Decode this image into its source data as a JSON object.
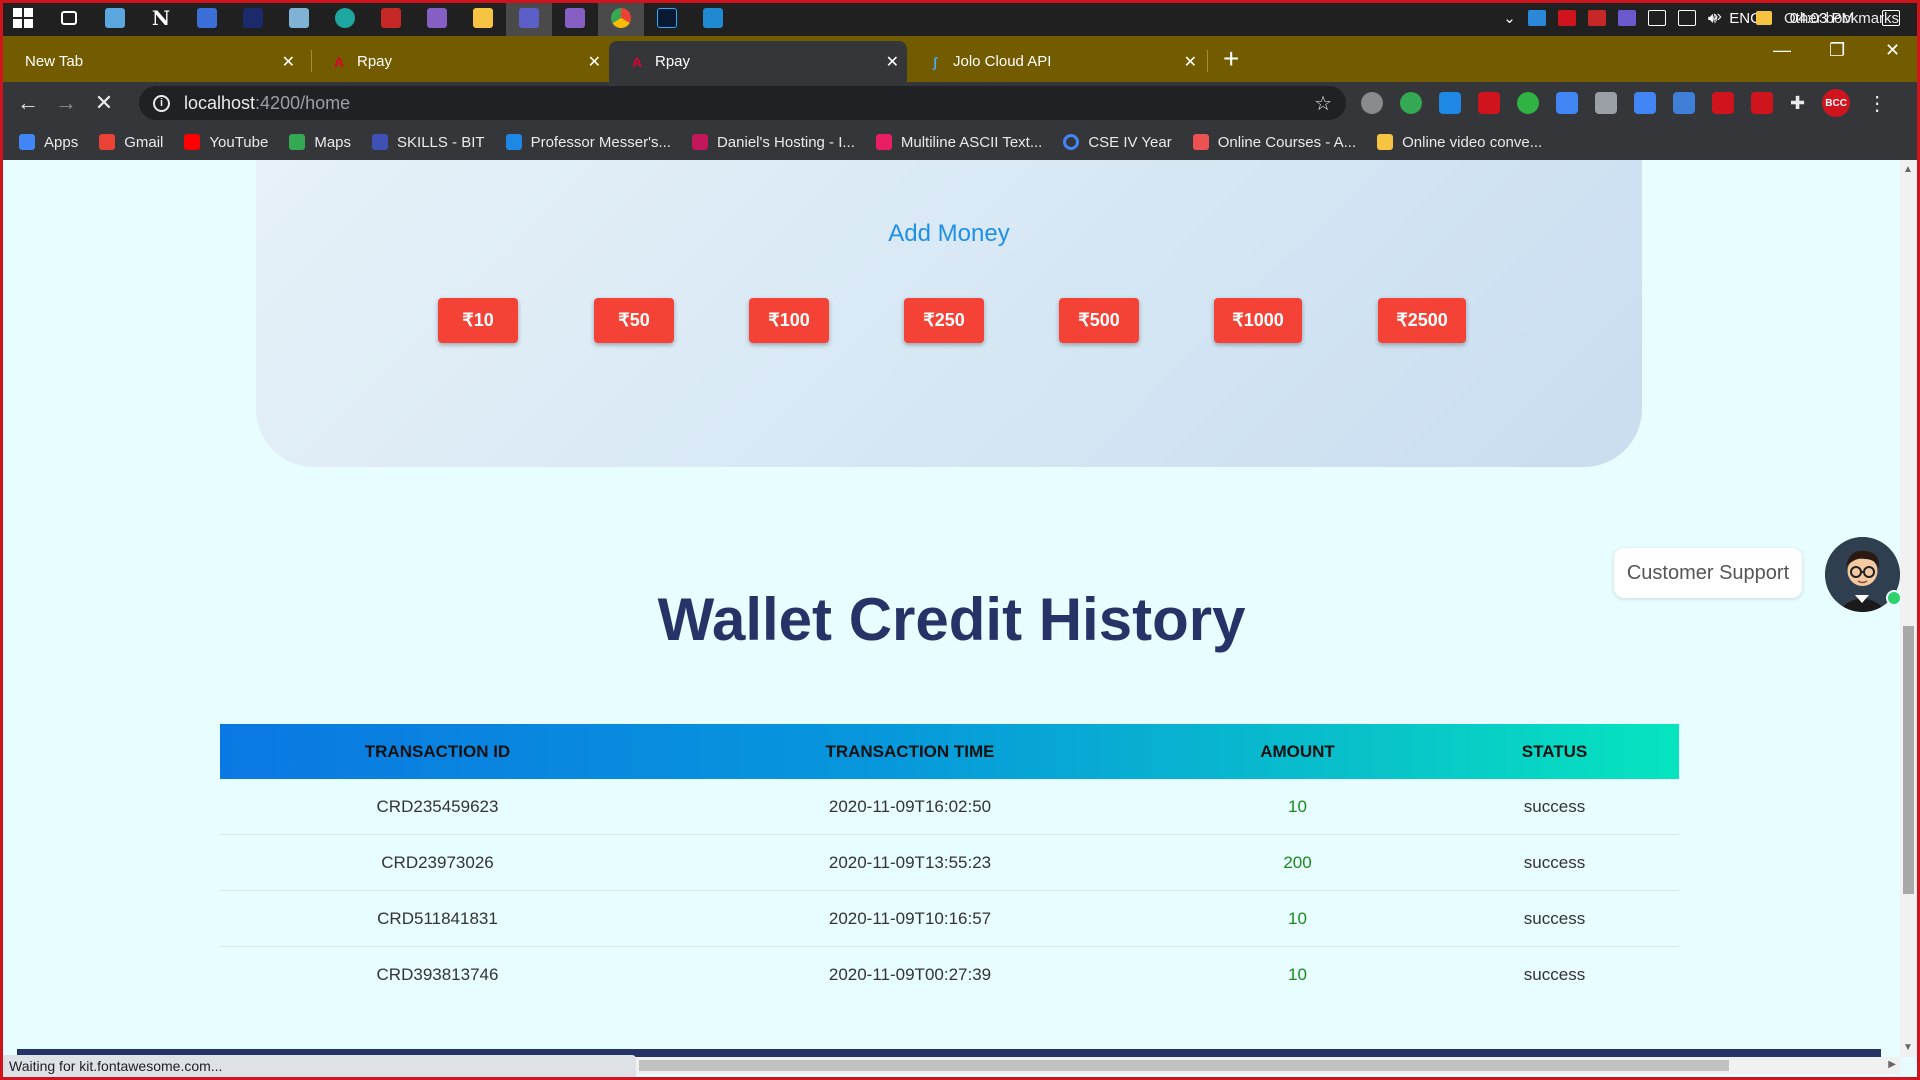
{
  "taskbar": {
    "icons": [
      "windows-icon",
      "task-view-icon",
      "calculator-icon",
      "notion-icon",
      "app-icon",
      "blackberry-icon",
      "photos-icon",
      "edge-icon",
      "app-icon",
      "visual-studio-icon",
      "file-explorer-icon",
      "teams-icon",
      "visual-studio-icon",
      "chrome-icon",
      "photoshop-icon",
      "vscode-icon"
    ],
    "tray": {
      "language": "ENG",
      "time": "04:03 PM"
    }
  },
  "tabs": [
    {
      "title": "New Tab",
      "icon": "none",
      "active": false
    },
    {
      "title": "Rpay",
      "icon": "angular-icon",
      "active": false
    },
    {
      "title": "Rpay",
      "icon": "angular-icon",
      "active": true
    },
    {
      "title": "Jolo Cloud API",
      "icon": "jolo-icon",
      "active": false
    }
  ],
  "address": {
    "host": "localhost",
    "path": ":4200/home"
  },
  "bookmarks": [
    {
      "label": "Apps",
      "icon": "apps-grid-icon",
      "color": "#4285f4"
    },
    {
      "label": "Gmail",
      "icon": "gmail-icon",
      "color": "#ea4335"
    },
    {
      "label": "YouTube",
      "icon": "youtube-icon",
      "color": "#ff0000"
    },
    {
      "label": "Maps",
      "icon": "maps-icon",
      "color": "#34a853"
    },
    {
      "label": "SKILLS - BIT",
      "icon": "skills-icon",
      "color": "#3f51b5"
    },
    {
      "label": "Professor Messer's...",
      "icon": "messer-icon",
      "color": "#1e88e5"
    },
    {
      "label": "Daniel's Hosting - I...",
      "icon": "raspberry-icon",
      "color": "#c2185b"
    },
    {
      "label": "Multiline ASCII Text...",
      "icon": "ascii-icon",
      "color": "#e91e63"
    },
    {
      "label": "CSE IV Year",
      "icon": "google-icon",
      "color": "#ffffff"
    },
    {
      "label": "Online Courses - A...",
      "icon": "udemy-icon",
      "color": "#ec5252"
    },
    {
      "label": "Online video conve...",
      "icon": "converter-icon",
      "color": "#f6c343"
    }
  ],
  "bookmarks_more": "»",
  "other_bookmarks": "Other bookmarks",
  "add_money": {
    "title": "Add Money",
    "amounts": [
      "₹10",
      "₹50",
      "₹100",
      "₹250",
      "₹500",
      "₹1000",
      "₹2500"
    ],
    "button_color": "#f44336"
  },
  "support": {
    "label": "Customer Support"
  },
  "history": {
    "title": "Wallet Credit History",
    "columns": [
      "TRANSACTION ID",
      "TRANSACTION TIME",
      "AMOUNT",
      "STATUS"
    ],
    "rows": [
      {
        "id": "CRD235459623",
        "time": "2020-11-09T16:02:50",
        "amount": "10",
        "status": "success"
      },
      {
        "id": "CRD23973026",
        "time": "2020-11-09T13:55:23",
        "amount": "200",
        "status": "success"
      },
      {
        "id": "CRD511841831",
        "time": "2020-11-09T10:16:57",
        "amount": "10",
        "status": "success"
      },
      {
        "id": "CRD393813746",
        "time": "2020-11-09T00:27:39",
        "amount": "10",
        "status": "success"
      }
    ]
  },
  "status_bar": "Waiting for kit.fontawesome.com...",
  "colors": {
    "title": "#253366",
    "accent": "#1e90e8",
    "amount": "#1a8a1a"
  }
}
